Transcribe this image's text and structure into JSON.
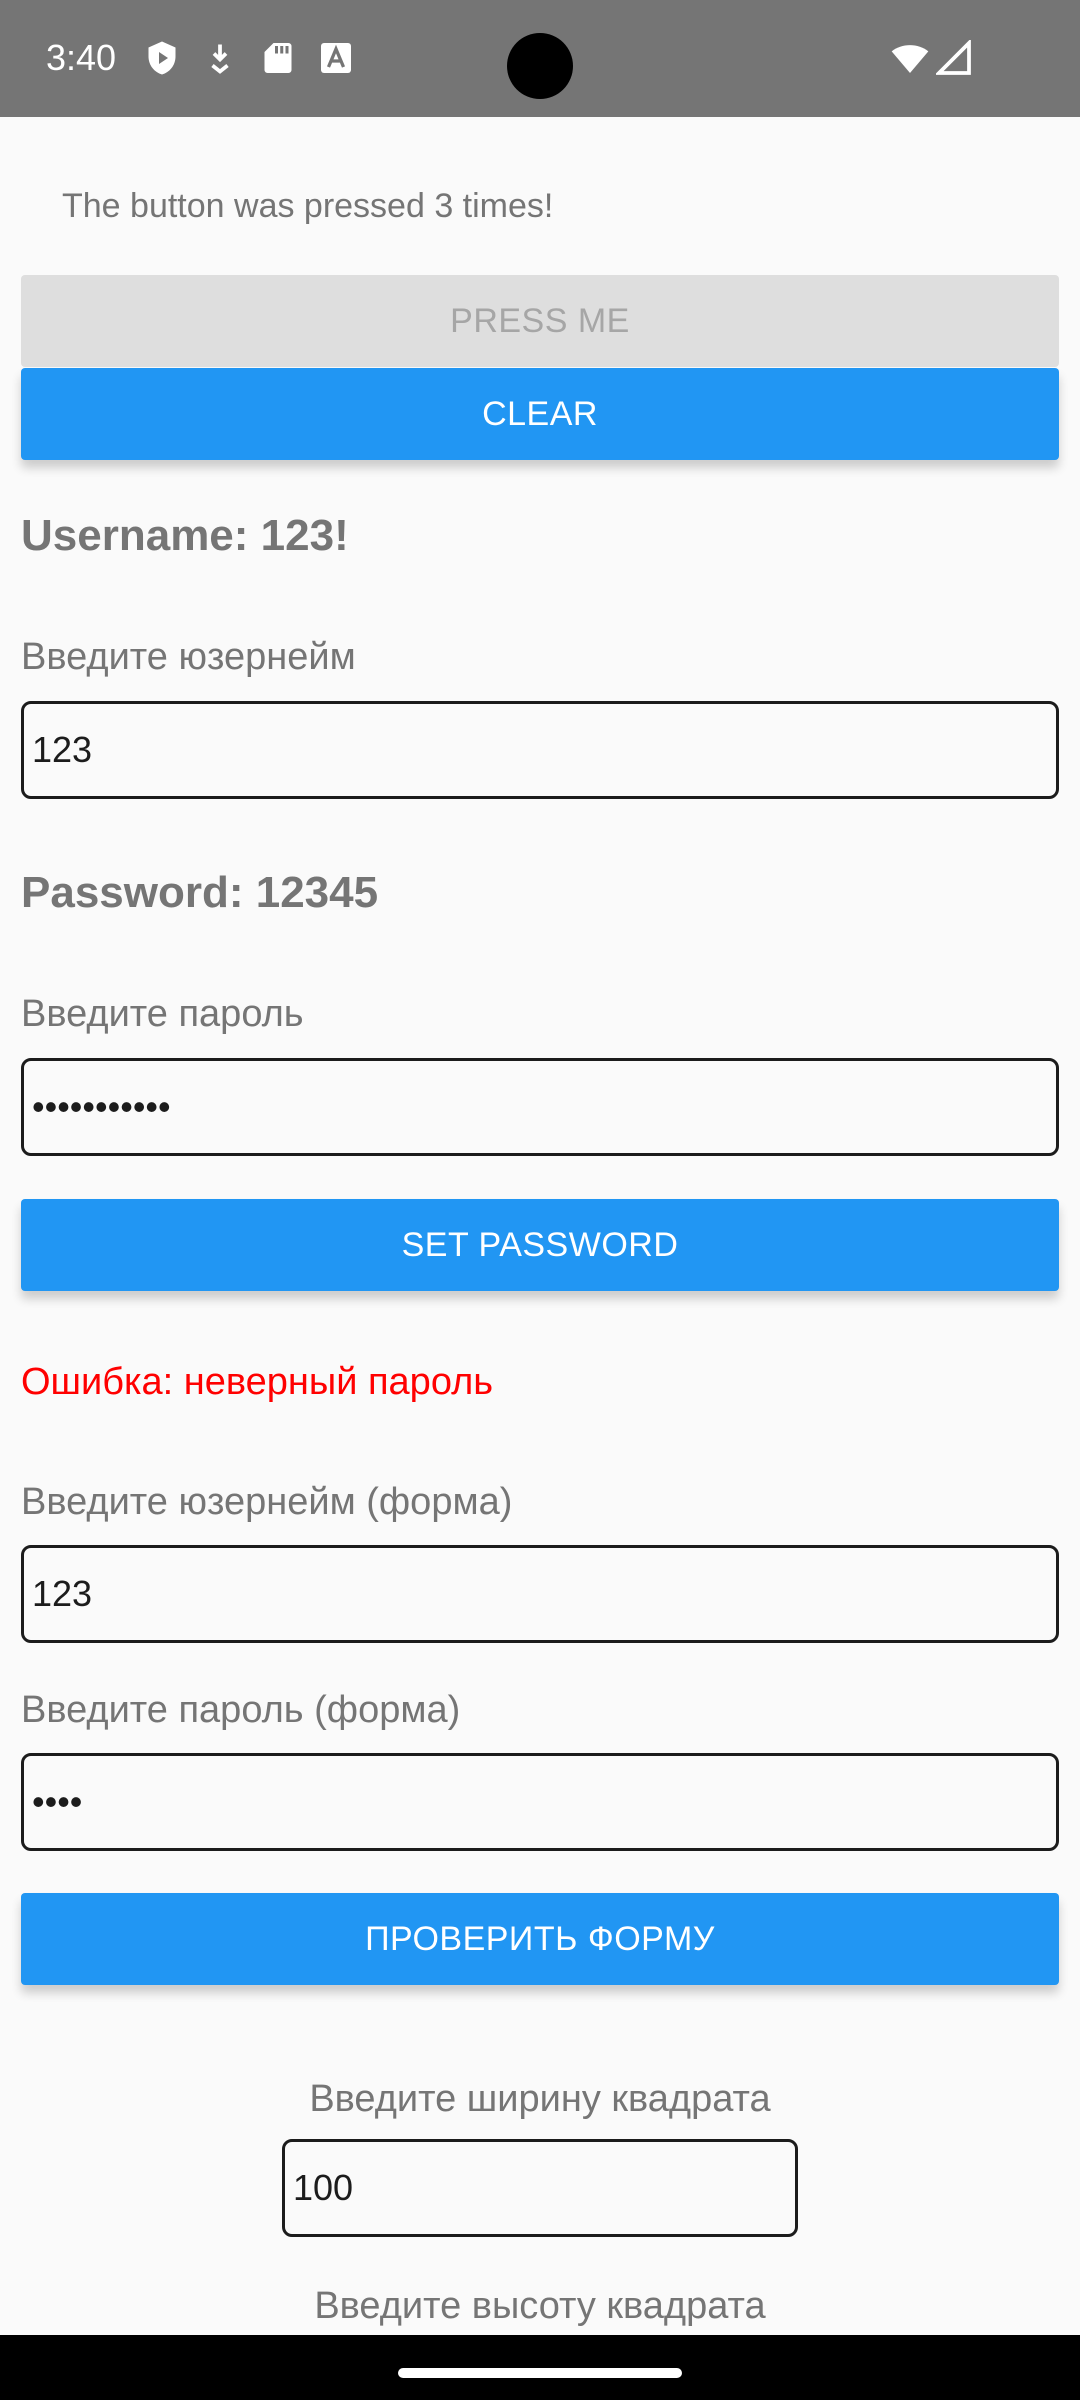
{
  "status_bar": {
    "time": "3:40",
    "left_icons": [
      "play-protect-icon",
      "download-icon",
      "sd-card-icon",
      "font-a-icon"
    ],
    "right_icons": [
      "wifi-icon",
      "signal-icon"
    ]
  },
  "counter": {
    "text": "The button was pressed 3 times!"
  },
  "buttons": {
    "press_me": "PRESS ME",
    "clear": "CLEAR",
    "set_password": "SET PASSWORD",
    "check_form": "ПРОВЕРИТЬ ФОРМУ"
  },
  "username": {
    "heading": "Username: 123!",
    "label": "Введите юзернейм",
    "value": "123"
  },
  "password": {
    "heading": "Password: 12345",
    "label": "Введите пароль",
    "value": "•••••••••••"
  },
  "error": {
    "text": "Ошибка: неверный пароль"
  },
  "form": {
    "username_label": "Введите юзернейм (форма)",
    "username_value": "123",
    "password_label": "Введите пароль (форма)",
    "password_value": "••••"
  },
  "square": {
    "width_label": "Введите ширину квадрата",
    "width_value": "100",
    "height_label": "Введите высоту квадрата"
  },
  "colors": {
    "primary": "#2196f3",
    "error": "#ff0000",
    "text_secondary": "#757575",
    "status_bar": "#757575"
  }
}
